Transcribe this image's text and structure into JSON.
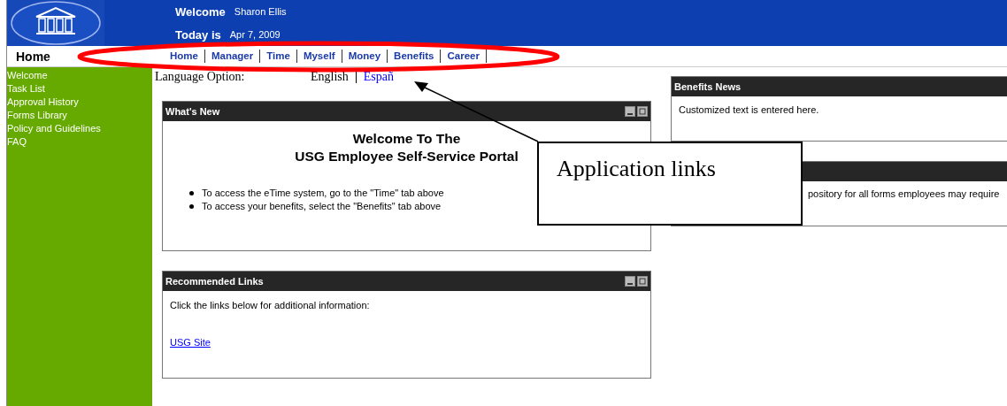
{
  "header": {
    "welcome_label": "Welcome",
    "user": "Sharon Ellis",
    "date_label": "Today is",
    "date": "Apr 7, 2009"
  },
  "nav": {
    "page_title": "Home",
    "tabs": [
      {
        "label": "Home"
      },
      {
        "label": "Manager"
      },
      {
        "label": "Time"
      },
      {
        "label": "Myself"
      },
      {
        "label": "Money"
      },
      {
        "label": "Benefits"
      },
      {
        "label": "Career"
      }
    ]
  },
  "sidebar": {
    "items": [
      "Welcome",
      "Task List",
      "Approval History",
      "Forms Library",
      "Policy and Guidelines",
      "FAQ"
    ]
  },
  "language": {
    "label": "Language Option:",
    "options": [
      {
        "label": "English",
        "selected": true
      },
      {
        "label": "Españ",
        "selected": false
      }
    ]
  },
  "left_panels": [
    {
      "kind": "welcome",
      "title": "What's New",
      "heading": [
        "Welcome To The",
        "USG Employee Self-Service Portal"
      ],
      "bullets": [
        "To access the eTime system, go to the \"Time\" tab above",
        "To access your benefits, select the \"Benefits\" tab above"
      ]
    },
    {
      "kind": "links",
      "title": "Recommended Links",
      "text": "Click the links below for additional information:",
      "link": "USG Site"
    }
  ],
  "right_panels": [
    {
      "title": "Benefits News",
      "text": "Customized text is entered here."
    },
    {
      "text": "pository for all forms employees may require"
    }
  ],
  "annotation": {
    "callout": "Application links"
  }
}
